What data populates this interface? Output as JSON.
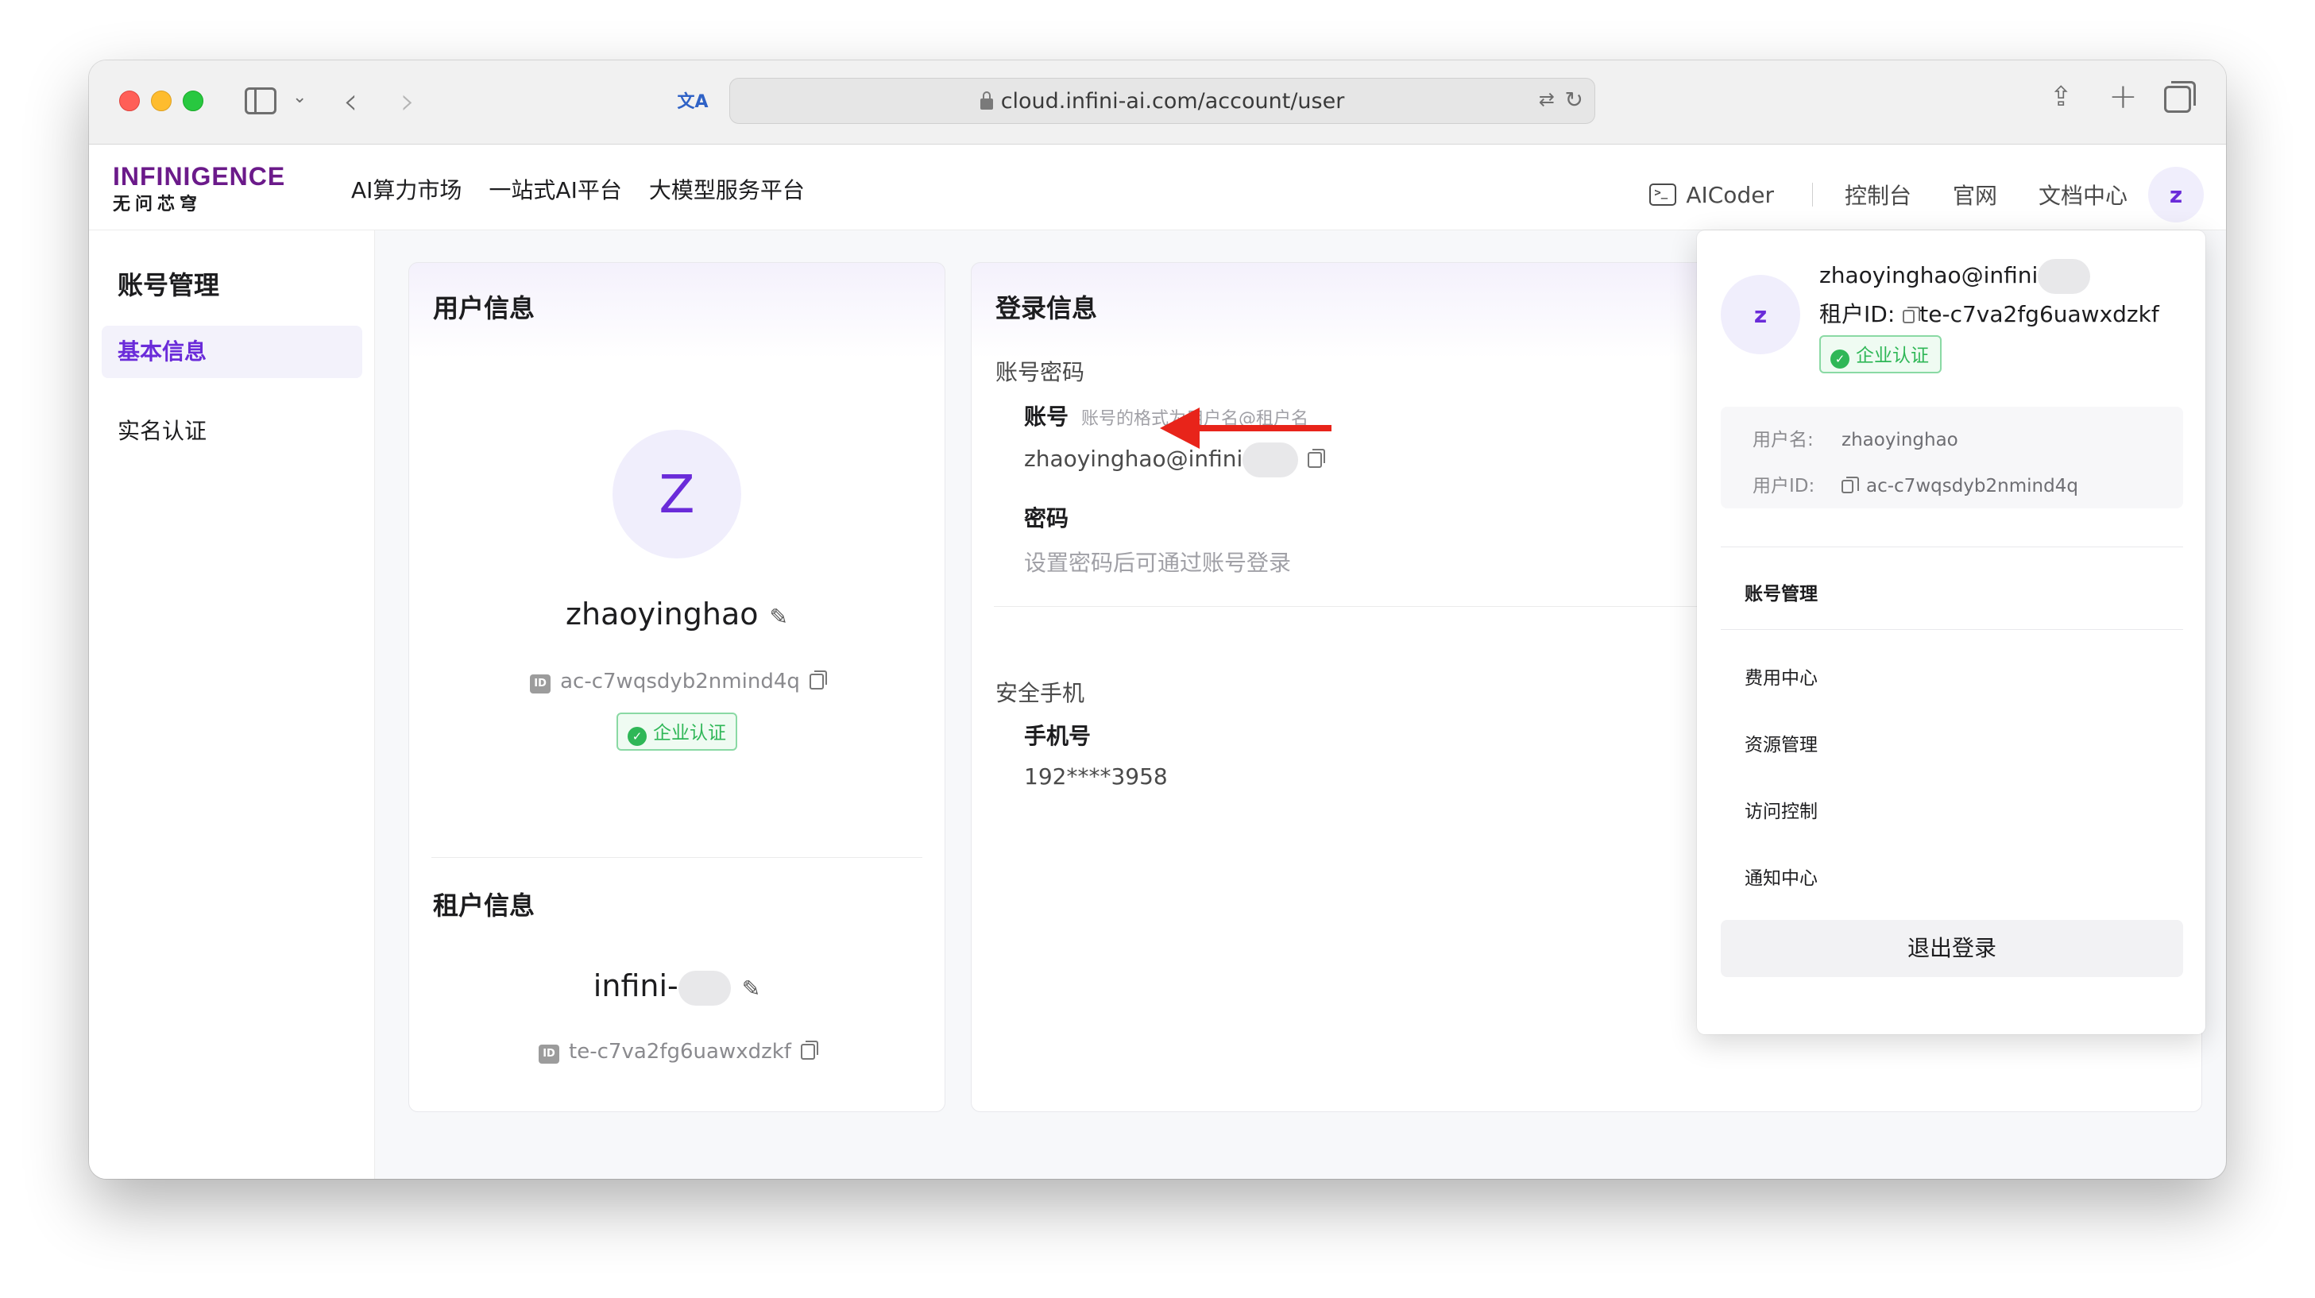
{
  "browser": {
    "url": "cloud.infini-ai.com/account/user"
  },
  "header": {
    "logo_en": "INFINIGENCE",
    "logo_cn": "无问芯穹",
    "nav": [
      "AI算力市场",
      "一站式AI平台",
      "大模型服务平台"
    ],
    "aicoder": "AICoder",
    "console": "控制台",
    "official_site": "官网",
    "docs": "文档中心",
    "avatar_letter": "z"
  },
  "sidemenu": {
    "title": "账号管理",
    "items": [
      "基本信息",
      "实名认证"
    ]
  },
  "user_card": {
    "title": "用户信息",
    "avatar_letter": "Z",
    "username": "zhaoyinghao",
    "id_badge": "ID",
    "user_id": "ac-c7wqsdyb2nmind4q",
    "verify_label": "企业认证",
    "tenant_title": "租户信息",
    "tenant_name": "infini-",
    "tenant_id": "te-c7va2fg6uawxdzkf"
  },
  "login_card": {
    "title": "登录信息",
    "section_account": "账号密码",
    "account_label": "账号",
    "account_hint": "账号的格式为用户名@租户名",
    "account_value": "zhaoyinghao@infini",
    "password_label": "密码",
    "password_hint": "设置密码后可通过账号登录",
    "section_phone": "安全手机",
    "phone_label": "手机号",
    "phone_value": "192****3958"
  },
  "dropdown": {
    "avatar_letter": "z",
    "email": "zhaoyinghao@infini",
    "tenant_label": "租户ID:",
    "tenant_id": "te-c7va2fg6uawxdzkf",
    "verify_label": "企业认证",
    "username_label": "用户名:",
    "username": "zhaoyinghao",
    "userid_label": "用户ID:",
    "user_id": "ac-c7wqsdyb2nmind4q",
    "menu": [
      "账号管理",
      "费用中心",
      "资源管理",
      "访问控制",
      "通知中心"
    ],
    "logout": "退出登录"
  },
  "colors": {
    "brand_purple": "#6a2bd9",
    "success_green": "#2fb757",
    "annotation_red": "#e8241a"
  }
}
